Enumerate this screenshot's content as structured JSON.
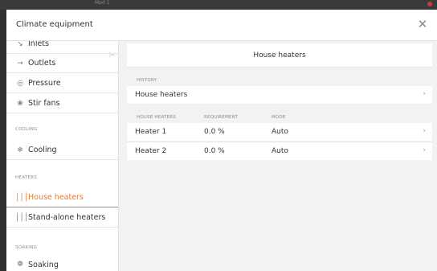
{
  "window": {
    "topbar_label": "Mod 1"
  },
  "dialog": {
    "title": "Climate equipment",
    "close_icon": "close-icon"
  },
  "sidebar": {
    "collapse_glyph": "|<-",
    "items_top": [
      {
        "icon": "arrow-in-icon",
        "glyph": "↘",
        "label": "Inlets"
      },
      {
        "icon": "arrow-out-icon",
        "glyph": "→",
        "label": "Outlets"
      },
      {
        "icon": "pressure-icon",
        "glyph": "◎",
        "label": "Pressure"
      },
      {
        "icon": "fan-icon",
        "glyph": "❀",
        "label": "Stir fans"
      }
    ],
    "cooling_section": "COOLING",
    "cooling_item": {
      "icon": "cooling-icon",
      "glyph": "❄",
      "label": "Cooling"
    },
    "heaters_section": "HEATERS",
    "heaters_items": [
      {
        "icon": "heat-icon",
        "glyph": "│││",
        "label": "House heaters",
        "active": true
      },
      {
        "icon": "heat-icon",
        "glyph": "│││",
        "label": "Stand-alone heaters",
        "active": false
      }
    ],
    "soaking_section": "SOAKING",
    "soaking_item": {
      "icon": "soaking-icon",
      "glyph": "❁",
      "label": "Soaking"
    }
  },
  "main": {
    "panel_title": "House heaters",
    "history_label": "HISTORY",
    "history_row_label": "House heaters",
    "table_headers": [
      "HOUSE HEATERS",
      "REQUIREMENT",
      "MODE"
    ],
    "rows": [
      {
        "name": "Heater 1",
        "requirement": "0.0 %",
        "mode": "Auto"
      },
      {
        "name": "Heater 2",
        "requirement": "0.0 %",
        "mode": "Auto"
      }
    ]
  },
  "colors": {
    "accent": "#e8782f",
    "background": "#f2f2f2",
    "overlay": "#303030"
  }
}
